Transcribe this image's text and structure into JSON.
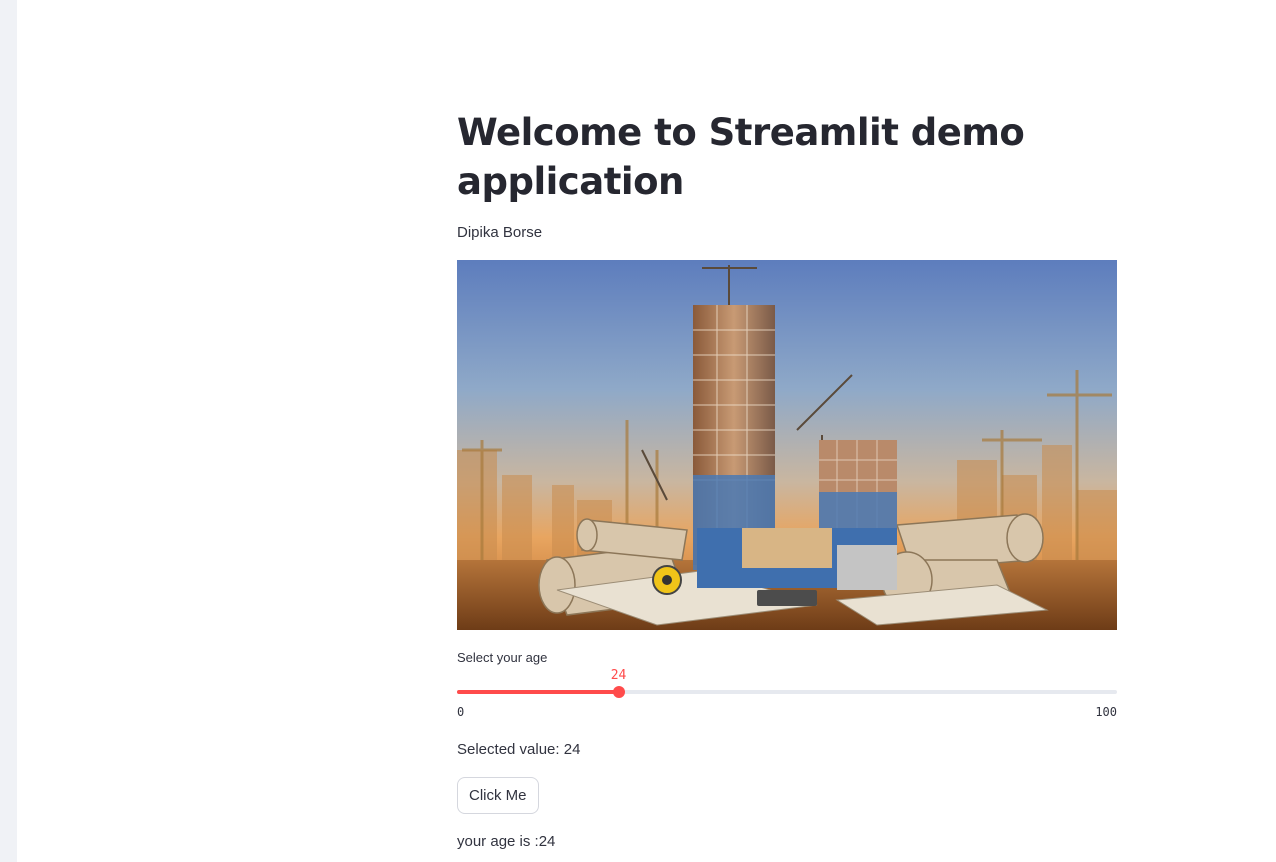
{
  "main": {
    "title": "Welcome to Streamlit demo application",
    "author": "Dipika Borse"
  },
  "slider": {
    "label": "Select your age",
    "value": 24,
    "value_text": "24",
    "min": 0,
    "max": 100,
    "min_text": "0",
    "max_text": "100",
    "accent": "#ff4b4b"
  },
  "output": {
    "selected_text": "Selected value: 24",
    "button_label": "Click Me",
    "age_text": "your age is :24"
  }
}
